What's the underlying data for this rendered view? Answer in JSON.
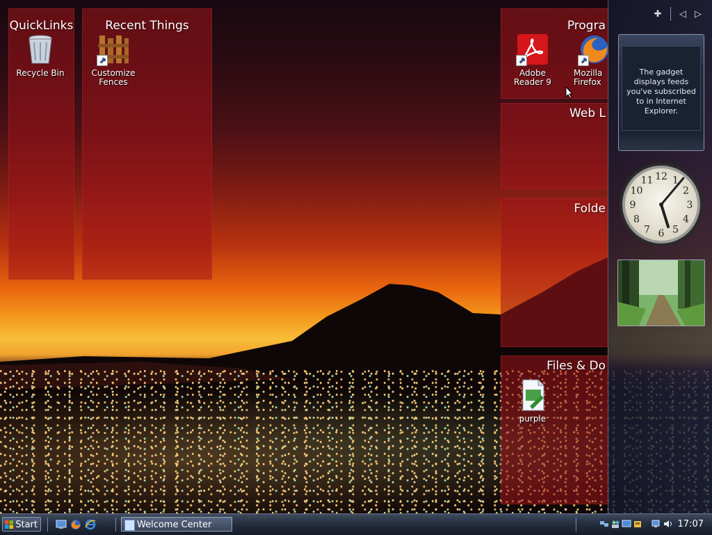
{
  "fences": {
    "quicklinks": {
      "title": "QuickLinks",
      "items": [
        {
          "label": "Recycle Bin",
          "icon": "recycle-bin-icon"
        }
      ]
    },
    "recent": {
      "title": "Recent Things",
      "items": [
        {
          "label": "Customize Fences",
          "icon": "fences-icon"
        }
      ]
    },
    "programs": {
      "title": "Progra",
      "items": [
        {
          "label": "Adobe Reader 9",
          "icon": "adobe-reader-icon"
        },
        {
          "label": "Mozilla Firefox",
          "icon": "firefox-icon"
        }
      ]
    },
    "weblinks": {
      "title": "Web L"
    },
    "folders": {
      "title": "Folde"
    },
    "files": {
      "title": "Files & Do",
      "items": [
        {
          "label": "purple",
          "icon": "document-icon"
        }
      ]
    }
  },
  "sidebar": {
    "controls": {
      "add": "✚",
      "prev": "◁",
      "next": "▷"
    },
    "feeds_text": "The gadget displays feeds you've subscribed to in Internet Explorer.",
    "clock_numbers": [
      "12",
      "1",
      "2",
      "3",
      "4",
      "5",
      "6",
      "7",
      "8",
      "9",
      "10",
      "11"
    ]
  },
  "taskbar": {
    "start_label": "Start",
    "task_label": "Welcome Center",
    "time": "17:07"
  },
  "colors": {
    "fence": "#a01419",
    "sidebar": "#1b2236",
    "taskbar": "#252e3f"
  }
}
